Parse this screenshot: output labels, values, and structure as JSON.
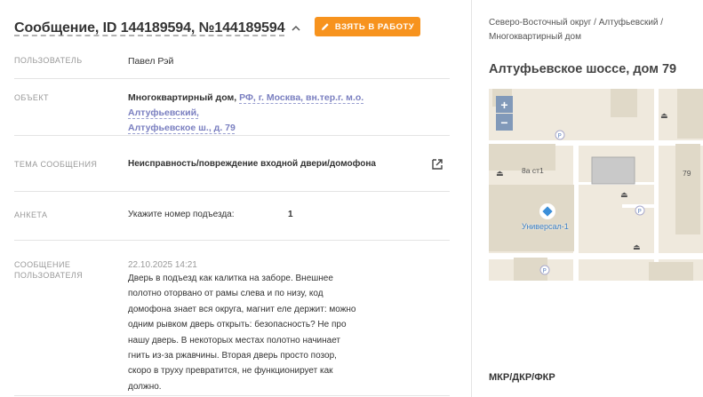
{
  "header": {
    "title": "Сообщение, ID 144189594, №144189594",
    "take_button": "ВЗЯТЬ В РАБОТУ"
  },
  "fields": {
    "user_label": "ПОЛЬЗОВАТЕЛЬ",
    "user_value": "Павел Рэй",
    "object_label": "ОБЪЕКТ",
    "object_type": "Многоквартирный дом,",
    "object_address_line1": "РФ, г. Москва, вн.тер.г. м.о. Алтуфьевский,",
    "object_address_line2": "Алтуфьевское ш., д. 79",
    "topic_label": "ТЕМА СООБЩЕНИЯ",
    "topic_value": "Неисправность/повреждение входной двери/домофона",
    "form_label": "АНКЕТА",
    "form_question": "Укажите номер подъезда:",
    "form_answer": "1",
    "message_label_line1": "СООБЩЕНИЕ",
    "message_label_line2": "ПОЛЬЗОВАТЕЛЯ",
    "message_date": "22.10.2025 14:21",
    "message_lines": [
      "Дверь в подъезд как калитка на заборе. Внешнее",
      "полотно оторвано от рамы слева и по низу, код",
      "домофона знает вся округа, магнит еле держит: можно",
      "одним рывком дверь открыть: безопасность? Не про",
      "нашу дверь. В некоторых местах полотно начинает",
      "гнить из-за ржавчины. Вторая дверь просто позор,",
      "скоро в труху превратится, не функционирует как",
      "должно."
    ]
  },
  "side": {
    "breadcrumb_line1": "Северо-Восточный округ / Алтуфьевский /",
    "breadcrumb_line2": "Многоквартирный дом",
    "address": "Алтуфьевское шоссе, дом 79",
    "map": {
      "zoom_in": "+",
      "zoom_out": "−",
      "label_8a": "8а ст1",
      "label_79": "79",
      "poi_name": "Универсал-1",
      "parking": "P"
    },
    "bottom_label": "МКР/ДКР/ФКР"
  },
  "colors": {
    "accent": "#f7931e",
    "link": "#7a7fc0",
    "map_bg": "#efe9dd",
    "zoom_btn": "#8199b9"
  }
}
